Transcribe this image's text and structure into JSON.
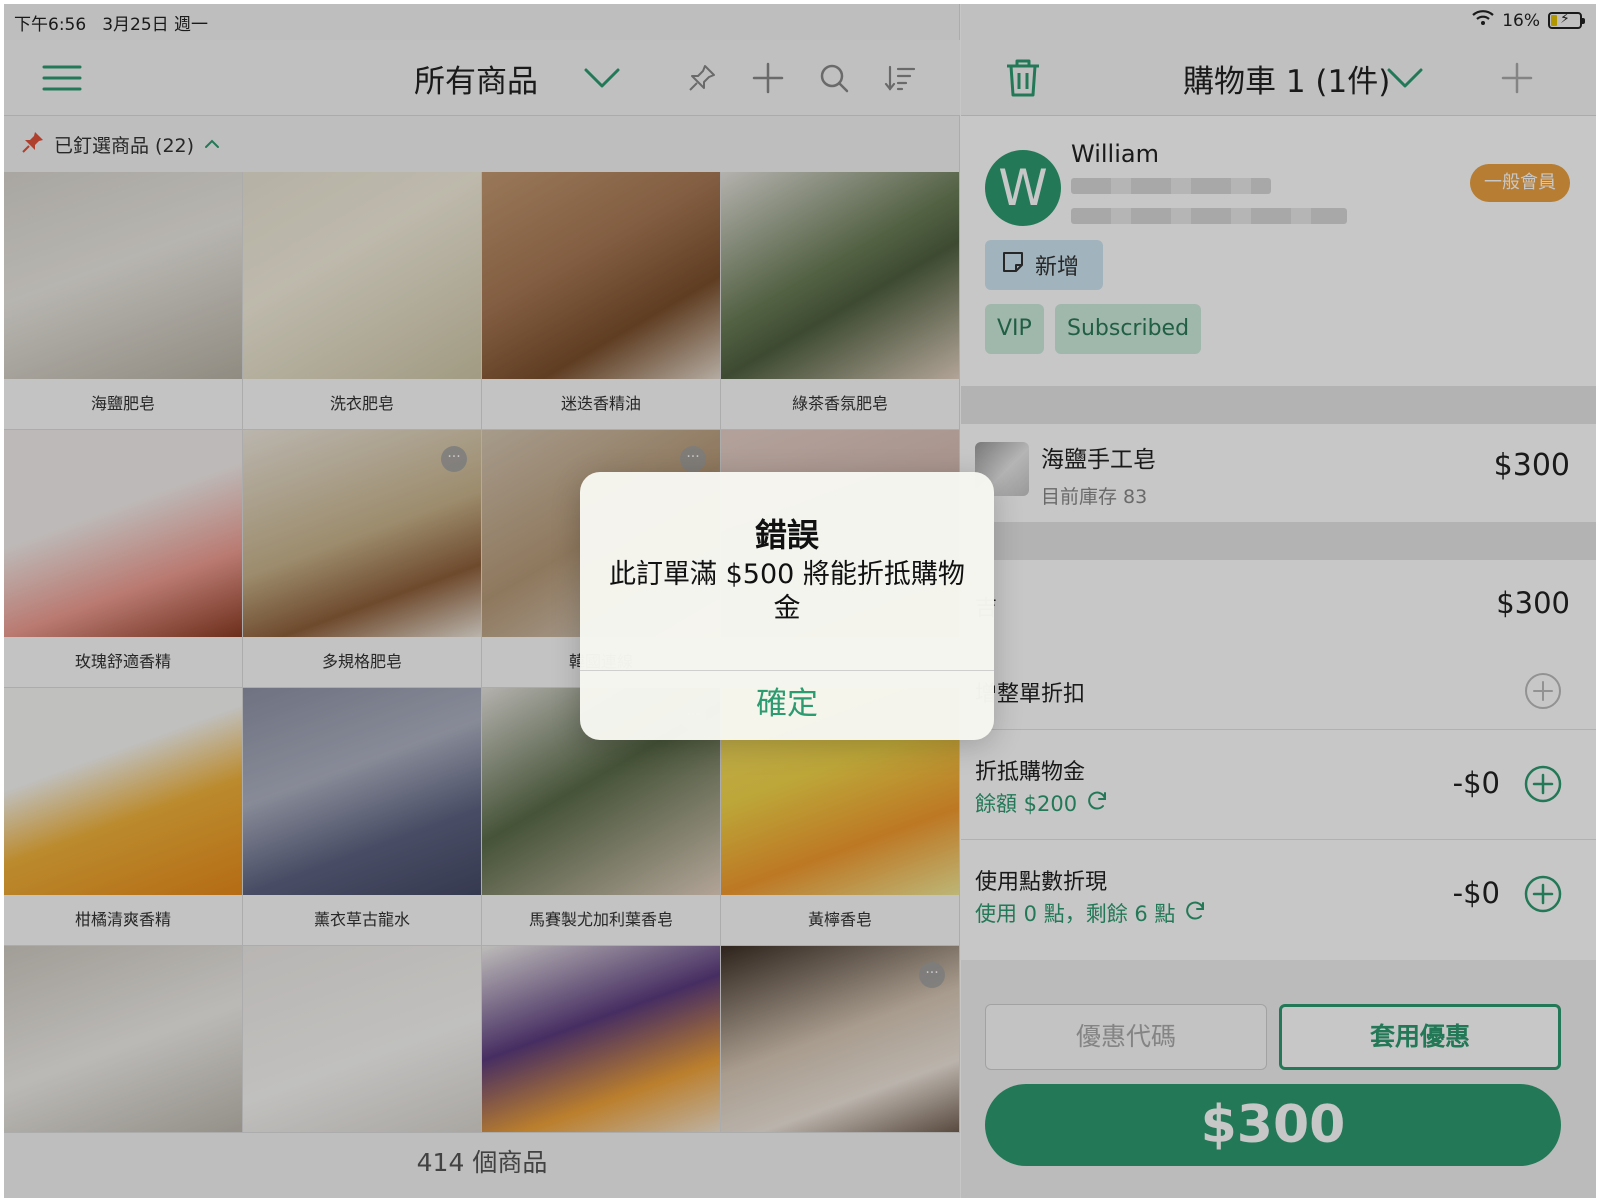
{
  "status_bar": {
    "time": "下午6:56",
    "date": "3月25日 週一",
    "battery": "16%"
  },
  "left_nav": {
    "title": "所有商品"
  },
  "pinned": {
    "label": "已釘選商品 (22)"
  },
  "products": [
    {
      "name": "海鹽肥皂",
      "gradient": "linear-gradient(160deg,#d9d6cf 0%,#ebe8e2 45%,#b9b3a6 100%)",
      "more": false
    },
    {
      "name": "洗衣肥皂",
      "gradient": "linear-gradient(150deg,#e9e4d4 0%,#f3eddc 40%,#cfc7a8 100%)",
      "more": false
    },
    {
      "name": "迷迭香精油",
      "gradient": "linear-gradient(150deg,#c49a72 0%,#a97955 40%,#7a4f2c 70%,#e8ddd0 100%)",
      "more": false
    },
    {
      "name": "綠茶香氛肥皂",
      "gradient": "linear-gradient(150deg,#e7e4df 0%,#6b7d57 45%,#4f6040 60%,#e5d3c3 100%)",
      "more": false
    },
    {
      "name": "玫瑰舒適香精",
      "gradient": "linear-gradient(160deg,#f2eeec 0%,#f2eeec 40%,#ef9d92 70%,#8a3a22 100%)",
      "more": false
    },
    {
      "name": "多規格肥皂",
      "gradient": "linear-gradient(160deg,#efe9df 0%,#c9b48c 50%,#8e5f3a 75%,#efe9df 100%)",
      "more": true
    },
    {
      "name": "韓國連線",
      "gradient": "linear-gradient(150deg,#d6c7b2 0%,#b79a78 50%,#e5dfd6 100%)",
      "more": true
    },
    {
      "name": "",
      "gradient": "linear-gradient(160deg,#e5cfc7 0%,#c7a79a 100%)",
      "more": false
    },
    {
      "name": "柑橘清爽香精",
      "gradient": "linear-gradient(160deg,#f6f6f4 0%,#f6f6f4 35%,#f0b23a 60%,#e98a1a 100%)",
      "more": false
    },
    {
      "name": "薰衣草古龍水",
      "gradient": "linear-gradient(160deg,#8e93a6 0%,#aeb2c2 40%,#5d6382 70%,#454a66 100%)",
      "more": false
    },
    {
      "name": "馬賽製尤加利葉香皂",
      "gradient": "linear-gradient(150deg,#e7e4df 0%,#5a6b48 45%,#e5d3c3 100%)",
      "more": true
    },
    {
      "name": "黃檸香皂",
      "gradient": "linear-gradient(160deg,#f7e16a 0%,#f3d64a 40%,#f29a2e 70%,#f3ea9a 100%)",
      "more": false
    },
    {
      "name": "",
      "gradient": "linear-gradient(160deg,#cfcac2 0%,#f0eeea 50%,#b9b4aa 100%)",
      "more": false
    },
    {
      "name": "",
      "gradient": "linear-gradient(160deg,#ece9e6 0%,#f7f6f4 55%,#d6d2cc 100%)",
      "more": false
    },
    {
      "name": "",
      "gradient": "linear-gradient(160deg,#f3f1ee 0%,#5b3b7e 40%,#f0a33a 70%,#f3f1ee 100%)",
      "more": false
    },
    {
      "name": "",
      "gradient": "linear-gradient(160deg,#3b2e25 0%,#d8c8b6 45%,#efe6dc 70%,#5a4536 100%)",
      "more": true
    }
  ],
  "product_count": "414 個商品",
  "cart_nav": {
    "title": "購物車 1 (1件)"
  },
  "customer": {
    "initial": "W",
    "name": "William",
    "member_level": "一般會員",
    "add_note": "新增",
    "tags": [
      "VIP",
      "Subscribed"
    ]
  },
  "cart_item": {
    "name": "海鹽手工皂",
    "stock": "目前庫存 83",
    "price": "$300"
  },
  "summary": {
    "subtotal_label": "吉",
    "subtotal": "$300",
    "discount_label": "增整單折扣",
    "credit_label": "折抵購物金",
    "credit_balance": "餘額 $200",
    "credit_amount": "-$0",
    "points_label": "使用點數折現",
    "points_info": "使用 0 點，剩餘 6 點",
    "points_amount": "-$0"
  },
  "coupon": {
    "placeholder": "優惠代碼",
    "apply": "套用優惠"
  },
  "checkout": {
    "total": "$300"
  },
  "alert": {
    "title": "錯誤",
    "message": "此訂單滿 $500 將能折抵購物金",
    "ok": "確定"
  },
  "colors": {
    "accent": "#2d9b70",
    "badge": "#e9a042",
    "pin": "#e0523a"
  }
}
